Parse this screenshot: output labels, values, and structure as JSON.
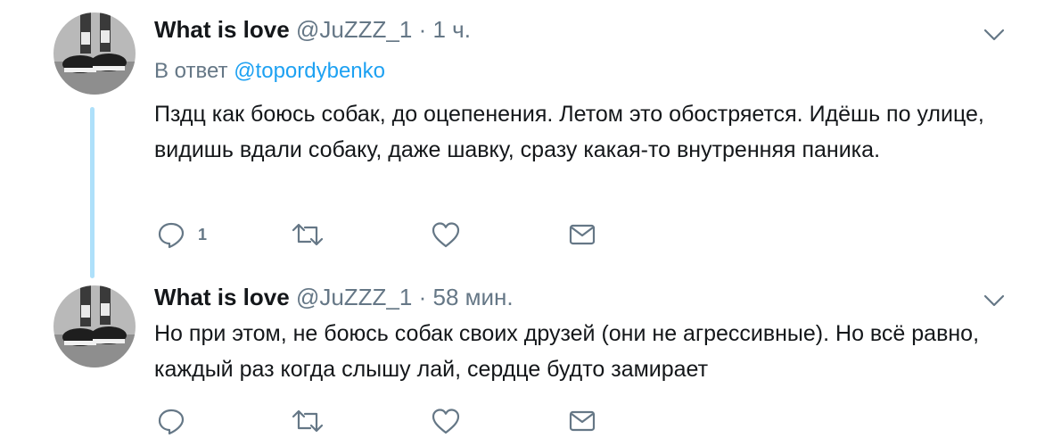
{
  "thread": {
    "tweets": [
      {
        "name": "What is love",
        "handle": "@JuZZZ_1",
        "separator": "·",
        "time": "1 ч.",
        "reply_prefix": "В ответ",
        "reply_mention": "@topordybenko",
        "text": "Пздц как боюсь собак, до оцепенения. Летом это обостряется.  Идёшь по улице, видишь вдали собаку, даже шавку,  сразу какая-то внутренняя паника.",
        "reply_count": "1"
      },
      {
        "name": "What is love",
        "handle": "@JuZZZ_1",
        "separator": "·",
        "time": "58 мин.",
        "text": "Но при этом, не боюсь собак своих друзей (они не агрессивные). Но всё равно, каждый раз когда слышу лай, сердце будто замирает",
        "reply_count": ""
      }
    ]
  },
  "colors": {
    "accent": "#1da1f2",
    "muted": "#657786",
    "thread_line": "#aee0fa",
    "text": "#14171a"
  },
  "icons": {
    "reply": "reply-icon",
    "retweet": "retweet-icon",
    "like": "like-icon",
    "dm": "dm-icon",
    "more": "chevron-down-icon"
  }
}
